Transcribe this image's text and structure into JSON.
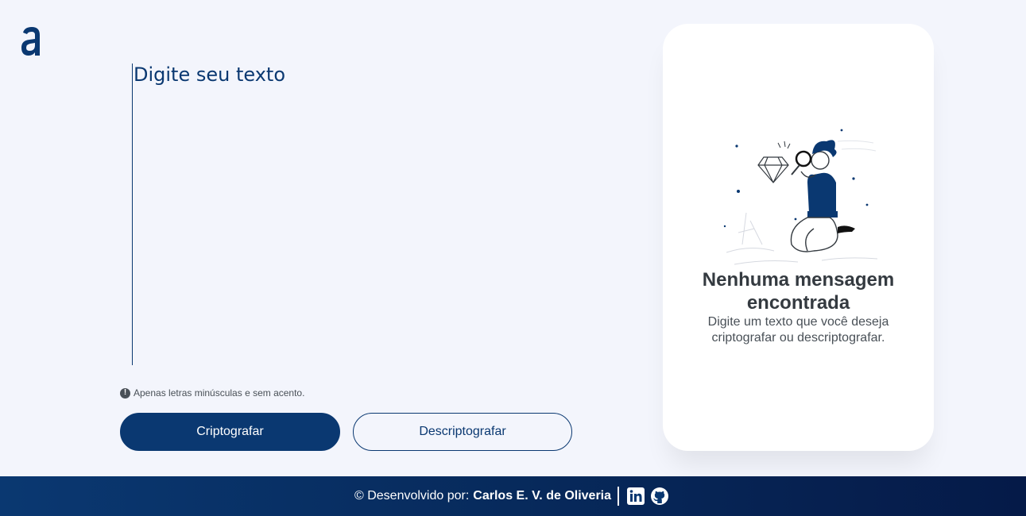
{
  "header": {
    "logo_icon": "alura-logo-icon"
  },
  "editor": {
    "placeholder": "Digite seu texto"
  },
  "hint": {
    "icon": "exclamation-circle-icon",
    "text": "Apenas letras minúsculas e sem acento."
  },
  "actions": {
    "encrypt_label": "Criptografar",
    "decrypt_label": "Descriptografar"
  },
  "result_card": {
    "illustration": "person-with-magnifier-illustration",
    "title": "Nenhuma mensagem encontrada",
    "text": "Digite um texto que você deseja criptografar ou descriptografar."
  },
  "footer": {
    "prefix": "© Desenvolvido por:",
    "author": "Carlos E. V. de Oliveria",
    "links": [
      "linkedin-icon",
      "github-icon"
    ]
  },
  "colors": {
    "primary": "#0a3871",
    "background": "#f3f5fc",
    "card": "#ffffff",
    "text_muted": "#495057"
  }
}
